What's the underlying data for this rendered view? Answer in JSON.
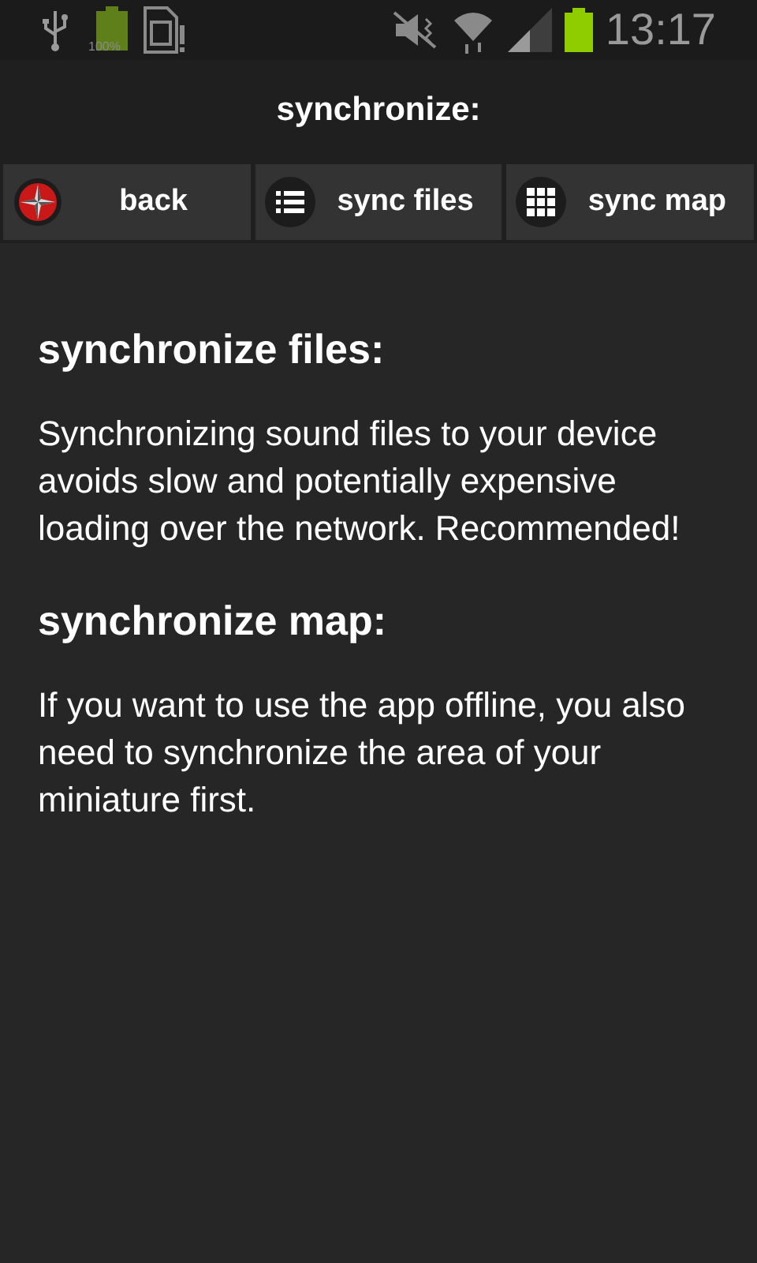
{
  "status_bar": {
    "battery_label": "100%",
    "time": "13:17"
  },
  "title": "synchronize:",
  "buttons": [
    {
      "label": "back",
      "kind": "compass"
    },
    {
      "label": "sync files",
      "kind": "list"
    },
    {
      "label": "sync map",
      "kind": "grid"
    }
  ],
  "sections": [
    {
      "heading": "synchronize files:",
      "text": "Synchronizing sound files to your device avoids slow and potentially expensive loading over the network. Recommended!"
    },
    {
      "heading": "synchronize map:",
      "text": "If you want to use the app offline, you also need to synchronize the area of your miniature first."
    }
  ]
}
